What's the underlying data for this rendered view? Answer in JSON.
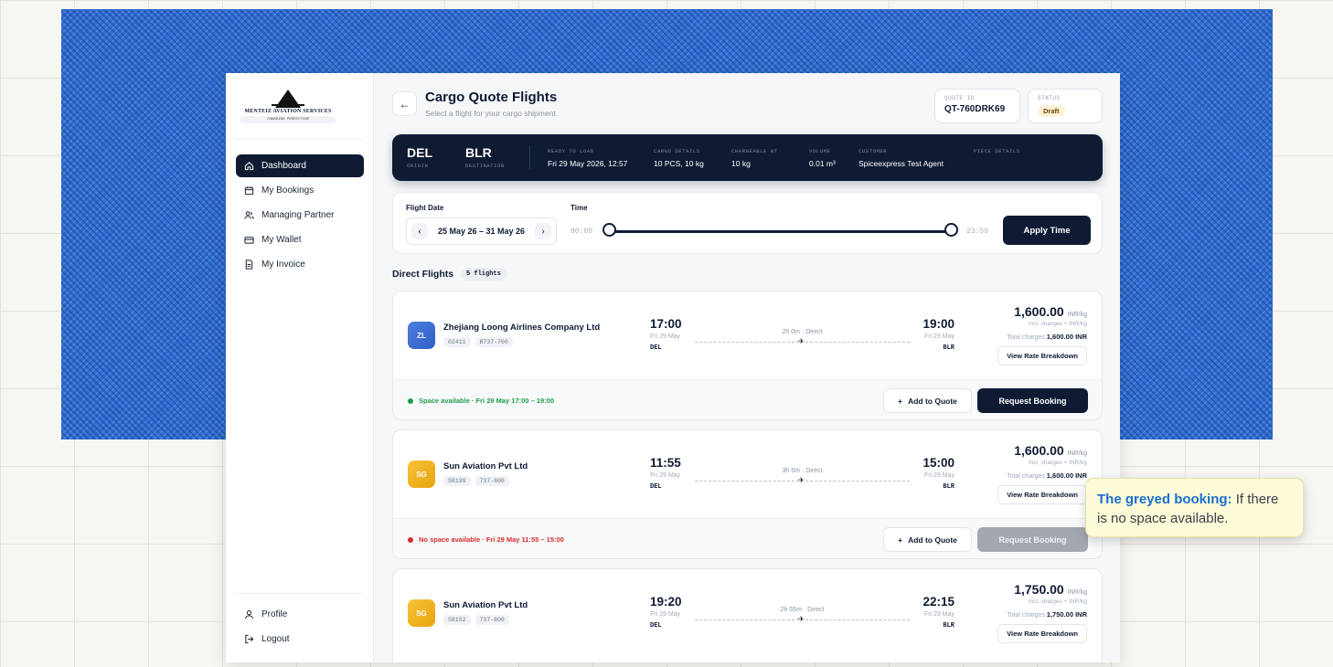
{
  "logo": {
    "name": "MENTEIZ AVIATION SERVICES",
    "tagline": "CHANGING PERFECTION"
  },
  "sidebar": {
    "items": [
      {
        "label": "Dashboard",
        "icon": "home-icon"
      },
      {
        "label": "My Bookings",
        "icon": "calendar-icon"
      },
      {
        "label": "Managing Partner",
        "icon": "users-icon"
      },
      {
        "label": "My Wallet",
        "icon": "wallet-icon"
      },
      {
        "label": "My Invoice",
        "icon": "invoice-icon"
      }
    ],
    "bottom": [
      {
        "label": "Profile",
        "icon": "user-icon"
      },
      {
        "label": "Logout",
        "icon": "logout-icon"
      }
    ]
  },
  "header": {
    "title": "Cargo Quote Flights",
    "subtitle": "Select a flight for your cargo shipment.",
    "quote_id_label": "QUOTE ID",
    "quote_id": "QT-760DRK69",
    "status_label": "STATUS",
    "status": "Draft"
  },
  "route": {
    "origin": "DEL",
    "origin_label": "ORIGIN",
    "destination": "BLR",
    "destination_label": "DESTINATION",
    "fields": [
      {
        "label": "READY TO LOAD",
        "value": "Fri 29 May 2026, 12:57"
      },
      {
        "label": "CARGO DETAILS",
        "value": "10 PCS, 10 kg"
      },
      {
        "label": "CHARGEABLE WT",
        "value": "10 kg"
      },
      {
        "label": "VOLUME",
        "value": "0.01 m³"
      },
      {
        "label": "CUSTOMER",
        "value": "Spiceexpress Test Agent"
      },
      {
        "label": "PIECE DETAILS",
        "value": ""
      }
    ]
  },
  "filter": {
    "date_label": "Flight Date",
    "date_range": "25 May 26 – 31 May 26",
    "time_label": "Time",
    "time_start": "00:00",
    "time_end": "23:59",
    "apply_label": "Apply Time"
  },
  "section": {
    "title": "Direct Flights",
    "count": "5 flights"
  },
  "flights": [
    {
      "initials": "ZL",
      "airline": "Zhejiang Loong Airlines Company Ltd",
      "tags": [
        "02411",
        "B737-700"
      ],
      "dep_time": "17:00",
      "dep_date": "Fri 29 May",
      "dep_code": "DEL",
      "arr_time": "19:00",
      "arr_date": "Fri 29 May",
      "arr_code": "BLR",
      "duration": "2h 0m · Direct",
      "price": "1,600.00",
      "price_unit": "INR/kg",
      "incl": "Incl. charges + INR/kg",
      "total_label": "Total charges",
      "total": "1,600.00 INR",
      "breakdown_label": "View Rate Breakdown",
      "availability": "Space available · Fri 29 May 17:00 – 19:00",
      "add_label": "Add to Quote",
      "request_label": "Request Booking",
      "available": true
    },
    {
      "initials": "SG",
      "airline": "Sun Aviation Pvt Ltd",
      "tags": [
        "S8199",
        "737-800"
      ],
      "dep_time": "11:55",
      "dep_date": "Fri 29 May",
      "dep_code": "DEL",
      "arr_time": "15:00",
      "arr_date": "Fri 29 May",
      "arr_code": "BLR",
      "duration": "3h 5m · Direct",
      "price": "1,600.00",
      "price_unit": "INR/kg",
      "incl": "Incl. charges + INR/kg",
      "total_label": "Total charges",
      "total": "1,600.00 INR",
      "breakdown_label": "View Rate Breakdown",
      "availability": "No space available · Fri 29 May 11:55 – 15:00",
      "add_label": "Add to Quote",
      "request_label": "Request Booking",
      "available": false
    },
    {
      "initials": "SG",
      "airline": "Sun Aviation Pvt Ltd",
      "tags": [
        "S8152",
        "737-800"
      ],
      "dep_time": "19:20",
      "dep_date": "Fri 29 May",
      "dep_code": "DEL",
      "arr_time": "22:15",
      "arr_date": "Fri 29 May",
      "arr_code": "BLR",
      "duration": "2h 55m · Direct",
      "price": "1,750.00",
      "price_unit": "INR/kg",
      "incl": "Incl. charges + INR/kg",
      "total_label": "Total charges",
      "total": "1,750.00 INR",
      "breakdown_label": "View Rate Breakdown"
    }
  ],
  "tooltip": {
    "title": "The greyed booking:",
    "text": "If there is no space available."
  },
  "colors": {
    "navy": "#0f1b33",
    "available": "#1f9d4b",
    "unavailable": "#d62b2b",
    "disabled": "#a3a8b0",
    "zl_avatar": "#3f6fd1",
    "sg_avatar": "#f2b21b"
  }
}
